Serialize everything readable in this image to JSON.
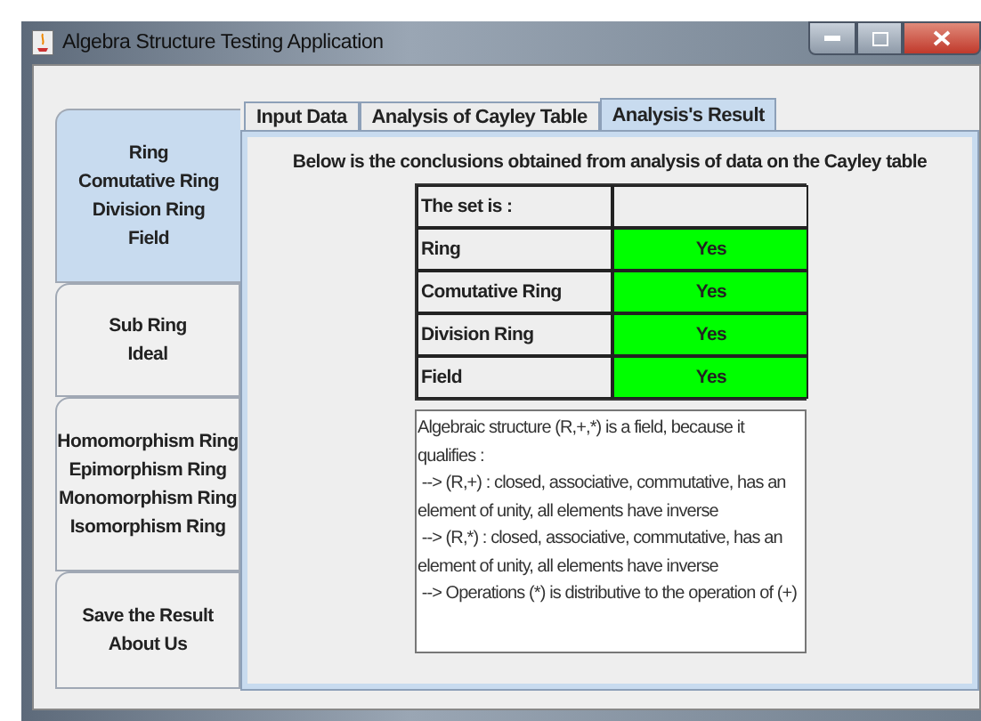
{
  "window": {
    "title": "Algebra Structure Testing Application"
  },
  "sidebar": {
    "tabs": [
      {
        "lines": [
          "Ring",
          "Comutative Ring",
          "Division Ring",
          "Field"
        ],
        "selected": true
      },
      {
        "lines": [
          "Sub Ring",
          "Ideal"
        ],
        "selected": false
      },
      {
        "lines": [
          "Homomorphism Ring",
          "Epimorphism Ring",
          "Monomorphism Ring",
          "Isomorphism Ring"
        ],
        "selected": false
      },
      {
        "lines": [
          "Save the Result",
          "About Us"
        ],
        "selected": false
      }
    ]
  },
  "tabs": [
    {
      "label": "Input Data",
      "selected": false
    },
    {
      "label": "Analysis of Cayley Table",
      "selected": false
    },
    {
      "label": "Analysis's Result",
      "selected": true
    }
  ],
  "heading": "Below is the conclusions obtained from analysis of data on the Cayley table",
  "table": {
    "header": [
      "The set is :"
    ],
    "rows": [
      {
        "name": "Ring",
        "result": "Yes",
        "color": "#00ff00"
      },
      {
        "name": "Comutative Ring",
        "result": "Yes",
        "color": "#00ff00"
      },
      {
        "name": "Division Ring",
        "result": "Yes",
        "color": "#00ff00"
      },
      {
        "name": "Field",
        "result": "Yes",
        "color": "#00ff00"
      }
    ]
  },
  "conclusion": {
    "lines": [
      "Algebraic structure (R,+,*) is a field, because it",
      "qualifies :",
      " --> (R,+) : closed, associative, commutative, has an",
      "element of unity, all elements have inverse",
      " --> (R,*) : closed, associative, commutative, has an",
      "element of unity, all elements have inverse",
      " --> Operations (*) is distributive to the operation of (+)"
    ]
  }
}
